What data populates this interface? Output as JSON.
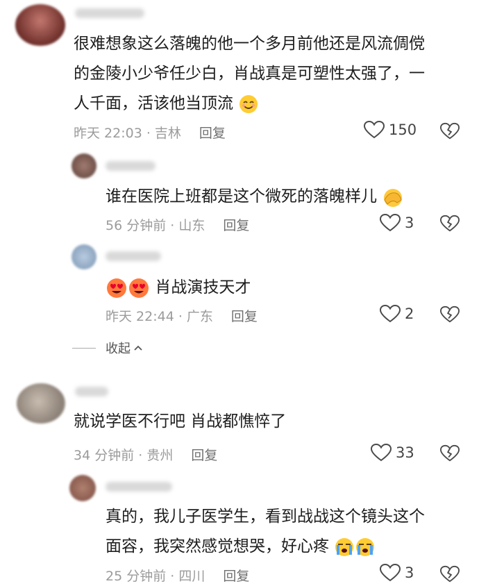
{
  "comments": [
    {
      "lines": [
        "很难想象这么落魄的他一个多月前他还是风流倜傥",
        "的金陵小少爷任少白，肖战真是可塑性太强了，一",
        "人千面，活该他当顶流"
      ],
      "time": "昨天 22:03 · 吉林",
      "reply": "回复",
      "likes": "150"
    },
    {
      "lines": [
        "谁在医院上班都是这个微死的落魄样儿"
      ],
      "time": "56 分钟前 · 山东",
      "reply": "回复",
      "likes": "3"
    },
    {
      "lines": [
        "肖战演技天才"
      ],
      "time": "昨天 22:44 · 广东",
      "reply": "回复",
      "likes": "2"
    },
    {
      "lines": [
        "就说学医不行吧 肖战都憔悴了"
      ],
      "time": "34 分钟前 · 贵州",
      "reply": "回复",
      "likes": "33"
    },
    {
      "lines": [
        "真的，我儿子医学生，看到战战这个镜头这个",
        "面容，我突然感觉想哭，好心疼"
      ],
      "time": "25 分钟前 · 四川",
      "reply": "回复",
      "likes": "3"
    }
  ],
  "collapse_label": "收起",
  "icons": {
    "like": "heart-outline-icon",
    "dislike": "broken-heart-icon",
    "emoji_smile": "smiling-face-emoji",
    "emoji_facepalm": "facepalm-emoji",
    "emoji_hearteyes": "heart-eyes-emoji",
    "emoji_crying": "loudly-crying-face-emoji"
  },
  "colors": {
    "meta": "#9b9b9b",
    "reply": "#6f6f6f",
    "text": "#1d1d1d"
  }
}
